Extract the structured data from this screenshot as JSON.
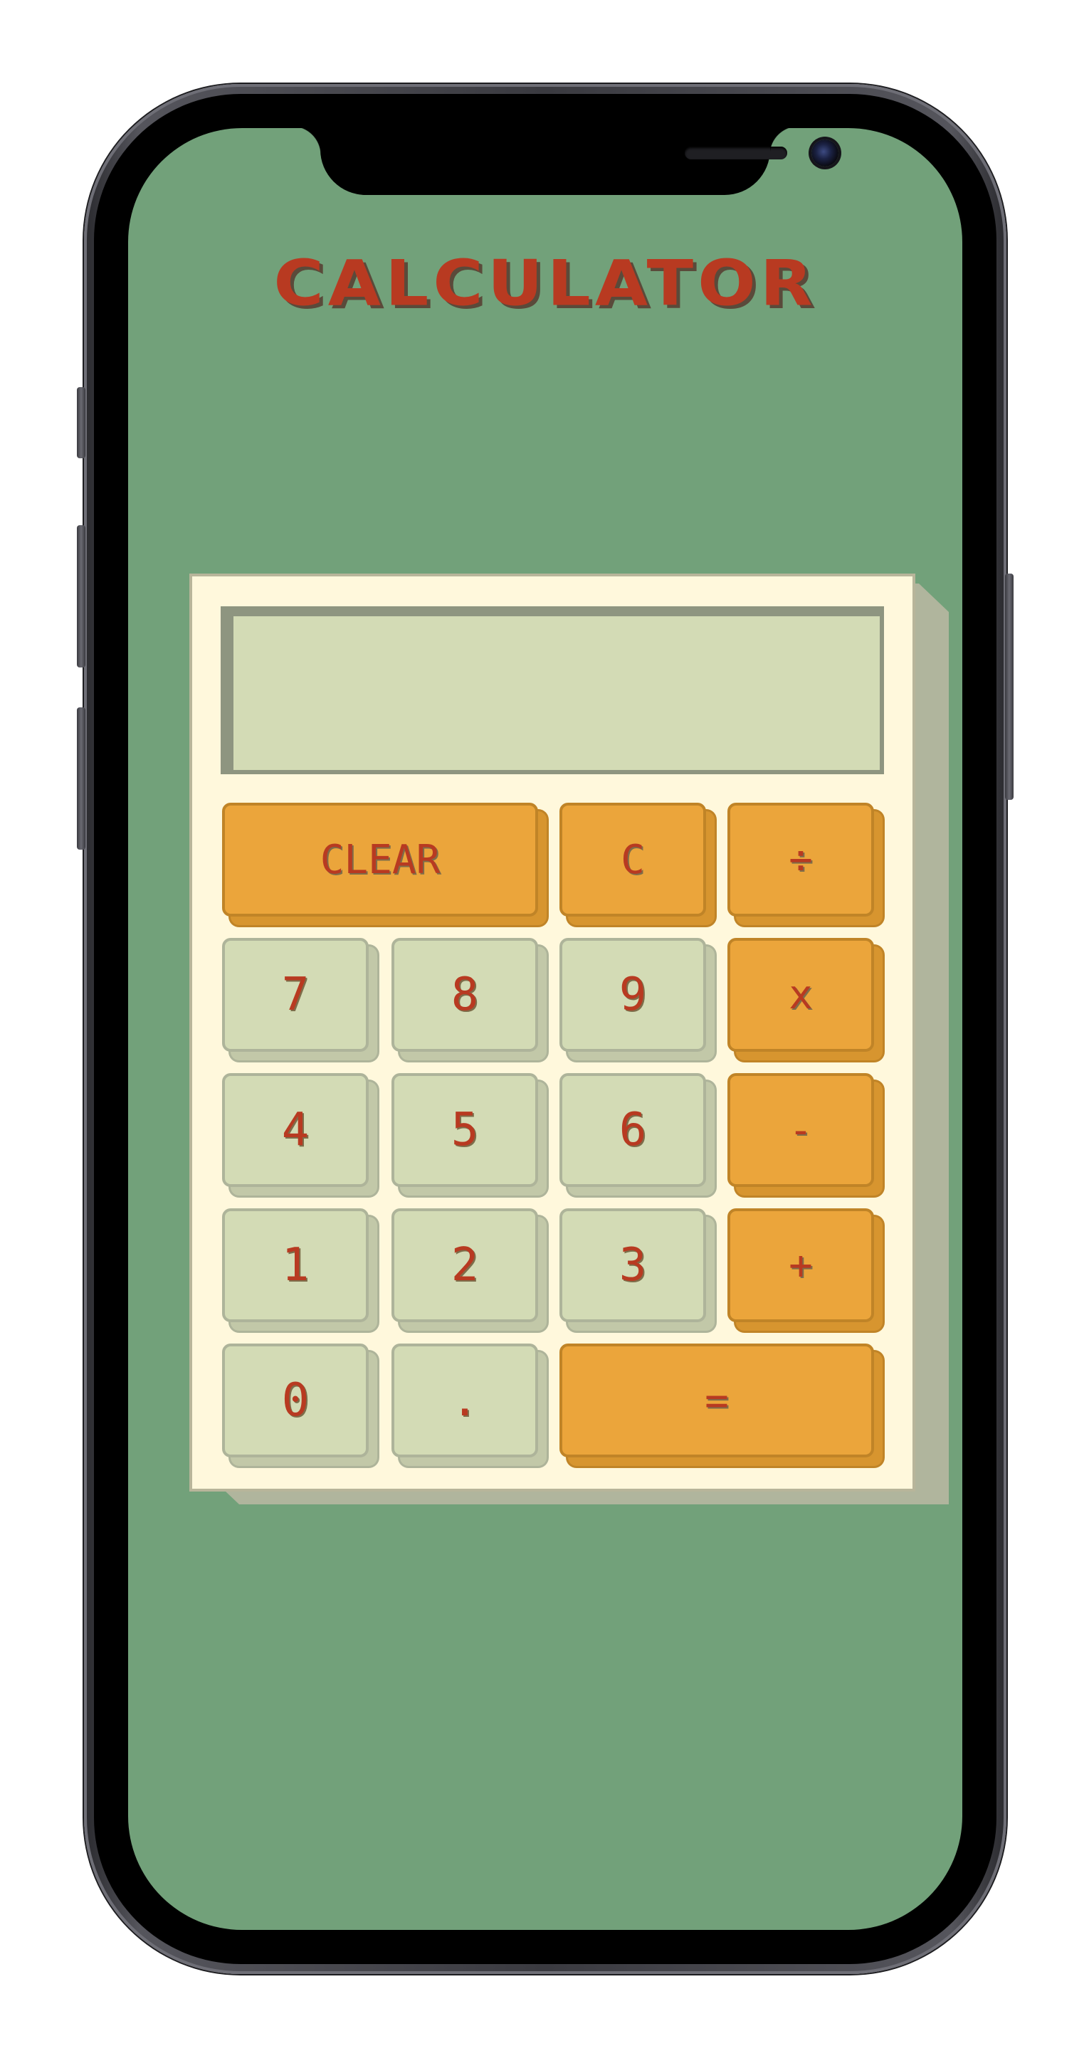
{
  "app": {
    "title": "CALCULATOR"
  },
  "display": {
    "value": ""
  },
  "keys": {
    "clear": "CLEAR",
    "backspace": "C",
    "divide": "÷",
    "seven": "7",
    "eight": "8",
    "nine": "9",
    "multiply": "x",
    "four": "4",
    "five": "5",
    "six": "6",
    "subtract": "-",
    "one": "1",
    "two": "2",
    "three": "3",
    "add": "+",
    "zero": "0",
    "decimal": ".",
    "equals": "="
  },
  "colors": {
    "screen_background": "#72a17a",
    "calculator_body": "#fff8dc",
    "display_background": "#d3dbb5",
    "number_key": "#d3dbb5",
    "operator_key": "#eba53b",
    "key_text": "#b83a21"
  }
}
